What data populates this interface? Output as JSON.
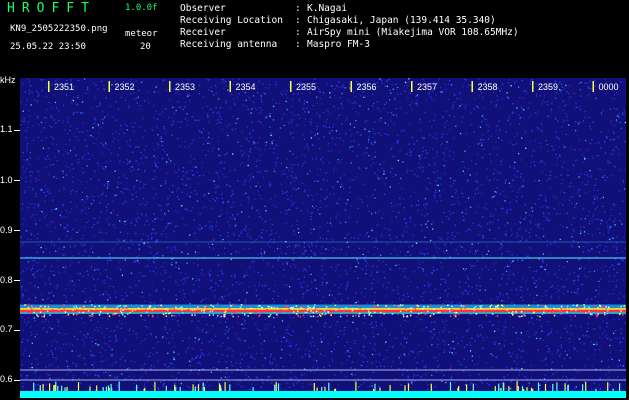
{
  "app": {
    "title": "HROFFT",
    "version": "1.0.0f"
  },
  "file": {
    "name": "KN9_2505222350.png",
    "timestamp": "25.05.22 23:50"
  },
  "meteor": {
    "label": "meteor",
    "count": "20"
  },
  "info": [
    {
      "key": "Observer",
      "value": "K.Nagai"
    },
    {
      "key": "Receiving Location",
      "value": "Chigasaki, Japan (139.414 35.340)"
    },
    {
      "key": "Receiver",
      "value": "AirSpy mini (Miakejima VOR 108.65MHz)"
    },
    {
      "key": "Receiving antenna",
      "value": "Maspro FM-3"
    }
  ],
  "axis": {
    "y_unit": "kHz",
    "y_ticks": [
      "1.1",
      "1.0",
      "0.9",
      "0.8",
      "0.7",
      "0.6"
    ],
    "x_ticks": [
      "2351",
      "2352",
      "2353",
      "2354",
      "2355",
      "2356",
      "2357",
      "2358",
      "2359",
      "0000"
    ]
  },
  "colors": {
    "title_green": "#19ff6a",
    "background": "#000000",
    "noise_base": "#1a1aa8",
    "carrier": "#ff3040",
    "bottom_bar": "#00ffff"
  }
}
